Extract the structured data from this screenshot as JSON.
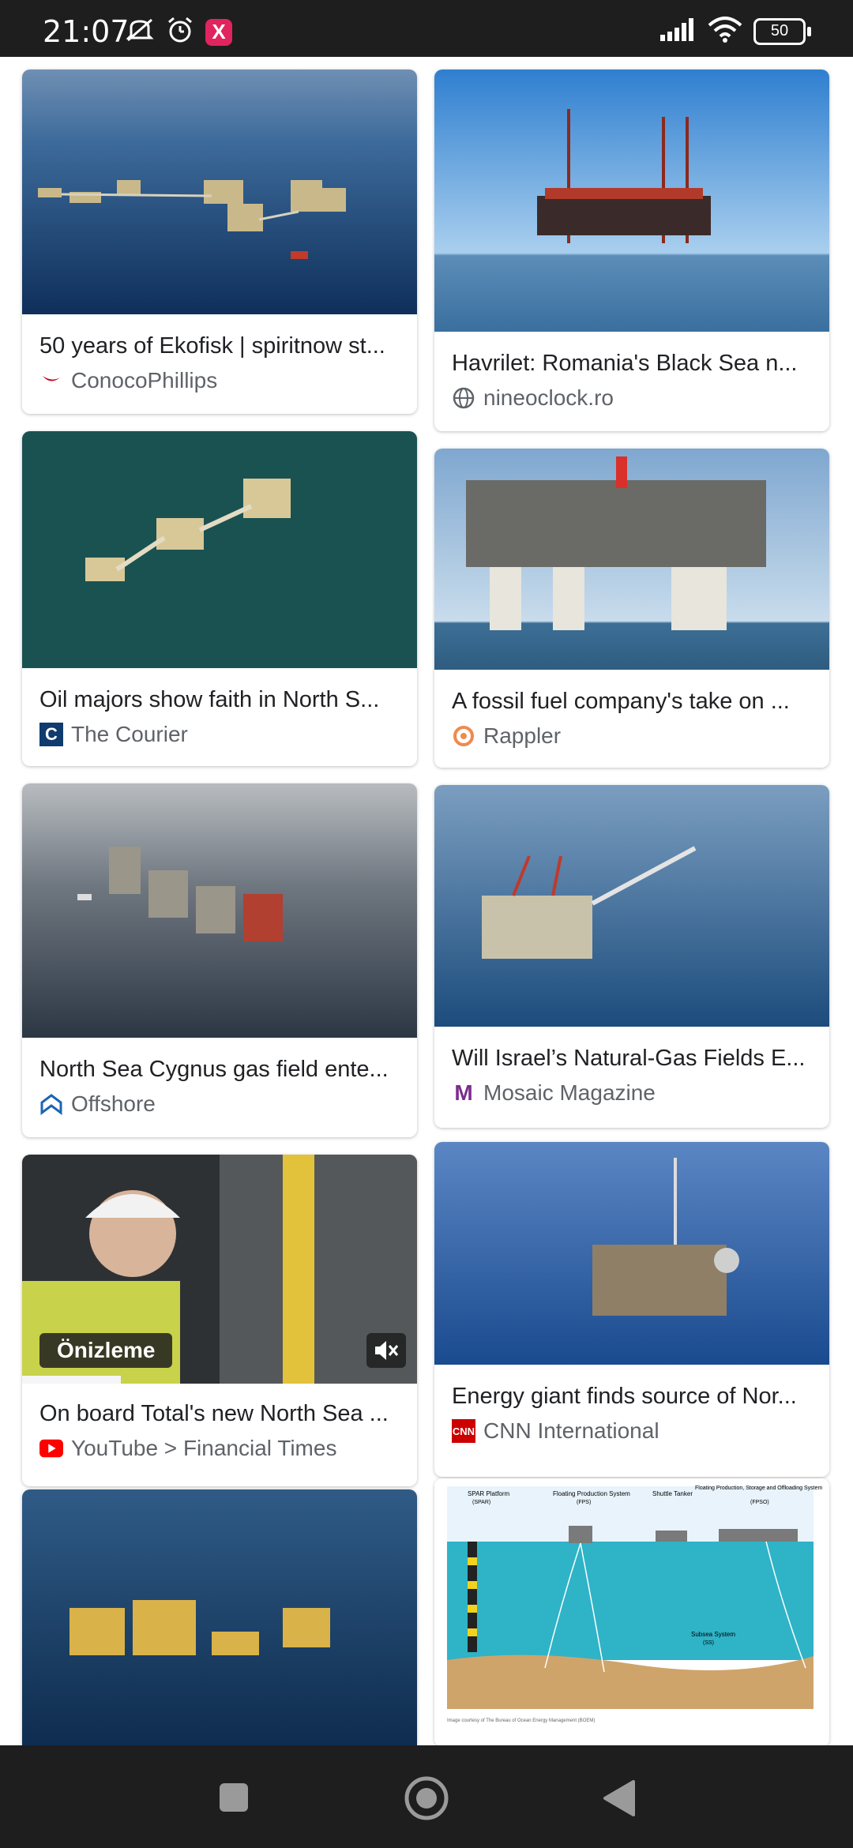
{
  "status_bar": {
    "time": "21:07",
    "left_icons": [
      "mute-icon",
      "alarm-icon",
      "app-notification-icon"
    ],
    "app_badge": "X",
    "right_icons": [
      "signal-icon",
      "wifi-icon",
      "battery-icon"
    ],
    "battery": "50"
  },
  "results": {
    "left": [
      {
        "title": "50 years of Ekofisk | spiritnow st...",
        "source": "ConocoPhillips",
        "icon": "conocophillips-logo-icon"
      },
      {
        "title": "Oil majors show faith in North S...",
        "source": "The Courier",
        "icon": "the-courier-logo-icon",
        "icon_text": "C"
      },
      {
        "title": "North Sea Cygnus gas field ente...",
        "source": "Offshore",
        "icon": "offshore-logo-icon"
      },
      {
        "title": "On board Total's new North Sea ...",
        "source": "YouTube > Financial Times",
        "icon": "youtube-logo-icon",
        "preview_label": "Önizleme"
      },
      {
        "title": "",
        "source": "",
        "icon": ""
      }
    ],
    "right": [
      {
        "title": "Havrilet: Romania's Black Sea n...",
        "source": "nineoclock.ro",
        "icon": "globe-icon"
      },
      {
        "title": "A fossil fuel company's take on ...",
        "source": "Rappler",
        "icon": "rappler-logo-icon"
      },
      {
        "title": "Will Israel’s Natural-Gas Fields E...",
        "source": "Mosaic Magazine",
        "icon": "mosaic-logo-icon",
        "icon_text": "M"
      },
      {
        "title": "Energy giant finds source of Nor...",
        "source": "CNN International",
        "icon": "cnn-logo-icon",
        "icon_text": "CNN"
      },
      {
        "title": "",
        "source": "",
        "icon": ""
      }
    ]
  },
  "diagram_labels": [
    "SPAR Platform",
    "(SPAR)",
    "Floating Production System",
    "(FPS)",
    "Shuttle Tanker",
    "Floating Production, Storage and Offloading System",
    "(FPSO)",
    "Subsea System",
    "(SS)",
    "Image courtesy of The Bureau of Ocean Energy Management (BOEM)"
  ],
  "nav_bar": [
    "recents-square-icon",
    "home-circle-icon",
    "back-triangle-icon"
  ]
}
